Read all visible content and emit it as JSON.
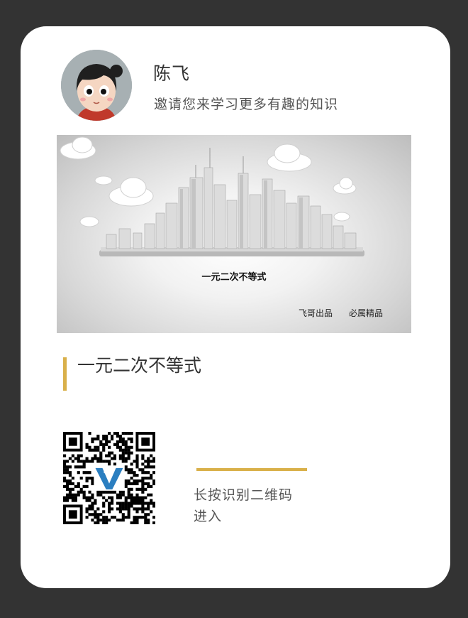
{
  "profile": {
    "name": "陈飞",
    "invite_text": "邀请您来学习更多有趣的知识"
  },
  "banner": {
    "title": "一元二次不等式",
    "footer_left": "飞哥出品",
    "footer_right": "必属精品"
  },
  "course": {
    "title": "一元二次不等式"
  },
  "qr": {
    "hint_line1": "长按识别二维码",
    "hint_line2": "进入"
  },
  "colors": {
    "page_background": "#333333",
    "card_background": "#ffffff",
    "accent_gold": "#d9b04a",
    "qr_logo_blue": "#2a7ec0"
  },
  "icons": {
    "avatar": "cartoon-girl-avatar",
    "qr_center_logo": "v-logo-icon"
  }
}
